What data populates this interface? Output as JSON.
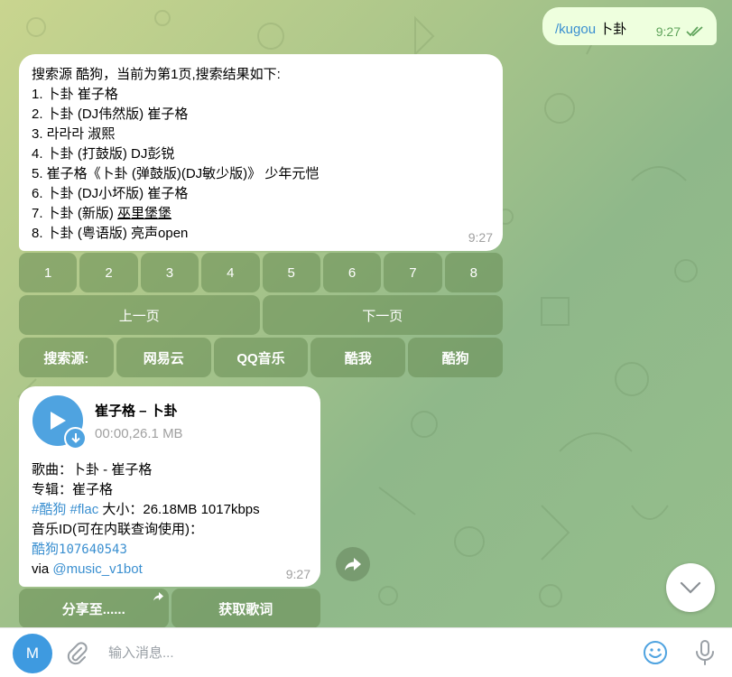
{
  "outgoing": {
    "command": "/kugou",
    "query": " 卜卦",
    "time": "9:27"
  },
  "results": {
    "lines": [
      "搜索源 酷狗，当前为第1页,搜索结果如下:",
      "1. 卜卦 崔子格",
      "2. 卜卦 (DJ伟然版) 崔子格",
      "3. 라라라 淑熙",
      "4. 卜卦 (打鼓版) DJ彭锐",
      "5. 崔子格《卜卦 (弹鼓版)(DJ敏少版)》 少年元恺",
      "6. 卜卦 (DJ小坏版) 崔子格",
      "7. 卜卦 (新版) ",
      "8. 卜卦 (粤语版) 亮声open"
    ],
    "line7_artist": "巫里堡堡",
    "time": "9:27"
  },
  "keyboard": {
    "numbers": [
      "1",
      "2",
      "3",
      "4",
      "5",
      "6",
      "7",
      "8"
    ],
    "prev": "上一页",
    "next": "下一页",
    "sources": [
      "搜索源:",
      "网易云",
      "QQ音乐",
      "酷我",
      "酷狗"
    ]
  },
  "audio": {
    "title": "崔子格 – 卜卦",
    "meta": "00:00,26.1 MB",
    "song": "歌曲：卜卦 - 崔子格",
    "album": "专辑：崔子格",
    "tag1": "#酷狗",
    "tag2": "#flac",
    "size": " 大小：26.18MB 1017kbps",
    "id_label": "音乐ID(可在内联查询使用)：",
    "id_prefix": "酷狗",
    "id_value": "107640543",
    "via": "via ",
    "bot": "@music_v1bot",
    "time": "9:27"
  },
  "actions": {
    "share": "分享至......",
    "lyrics": "获取歌词"
  },
  "composer": {
    "avatar": "M",
    "placeholder": "输入消息..."
  },
  "colors": {
    "accent": "#4fa3e0",
    "outgoing_bubble": "#eeffde",
    "keyboard_button": "#678c54"
  },
  "icons": [
    "play-icon",
    "download-icon",
    "forward-icon",
    "chevron-down-icon",
    "paperclip-icon",
    "emoji-icon",
    "microphone-icon",
    "double-check-icon"
  ]
}
